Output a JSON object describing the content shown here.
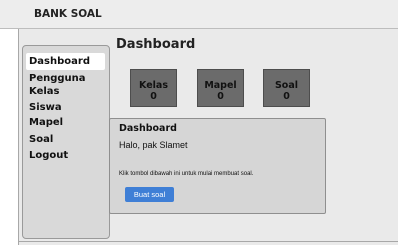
{
  "brand": "BANK SOAL",
  "sidebar": {
    "items": [
      {
        "label": "Dashboard",
        "active": true
      },
      {
        "label": "Pengguna"
      },
      {
        "label": "Kelas"
      },
      {
        "label": "Siswa"
      },
      {
        "label": "Mapel"
      },
      {
        "label": "Soal"
      },
      {
        "label": "Logout"
      }
    ]
  },
  "main": {
    "title": "Dashboard",
    "stats": [
      {
        "label": "Kelas",
        "value": "0"
      },
      {
        "label": "Mapel",
        "value": "0"
      },
      {
        "label": "Soal",
        "value": "0"
      }
    ],
    "panel": {
      "title": "Dashboard",
      "greeting": "Halo, pak Slamet",
      "hint": "Klik tombol dibawah ini untuk mulai membuat soal.",
      "button_label": "Buat soal"
    }
  },
  "colors": {
    "accent": "#3f7fd6",
    "stat_box": "#6b6b6b",
    "sidebar_bg": "#d9d9d9",
    "panel_bg": "#d6d6d6"
  }
}
